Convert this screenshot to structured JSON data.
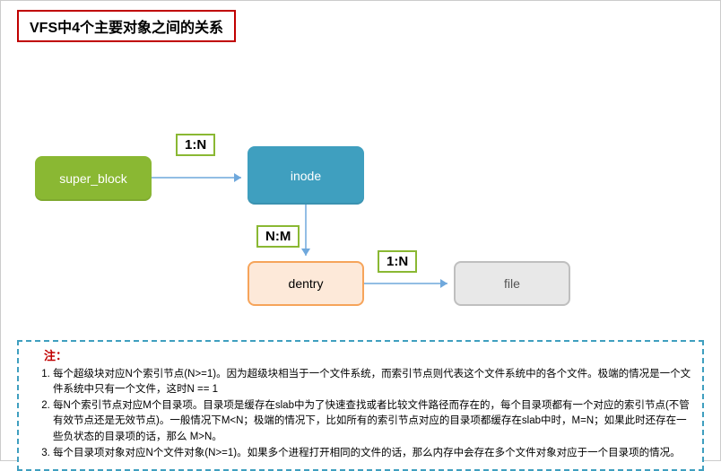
{
  "title": "VFS中4个主要对象之间的关系",
  "nodes": {
    "super_block": "super_block",
    "inode": "inode",
    "dentry": "dentry",
    "file": "file"
  },
  "edges": {
    "sb_inode": "1:N",
    "inode_dentry": "N:M",
    "dentry_file": "1:N"
  },
  "note": {
    "heading": "注：",
    "items": [
      "每个超级块对应N个索引节点(N>=1)。因为超级块相当于一个文件系统，而索引节点则代表这个文件系统中的各个文件。极端的情况是一个文件系统中只有一个文件，这时N == 1",
      "每N个索引节点对应M个目录项。目录项是缓存在slab中为了快速查找或者比较文件路径而存在的，每个目录项都有一个对应的索引节点(不管有效节点还是无效节点)。一般情况下M<N；极端的情况下，比如所有的索引节点对应的目录项都缓存在slab中时，M=N；如果此时还存在一些负状态的目录项的话，那么 M>N。",
      "每个目录项对象对应N个文件对象(N>=1)。如果多个进程打开相同的文件的话，那么内存中会存在多个文件对象对应于一个目录项的情况。"
    ]
  }
}
